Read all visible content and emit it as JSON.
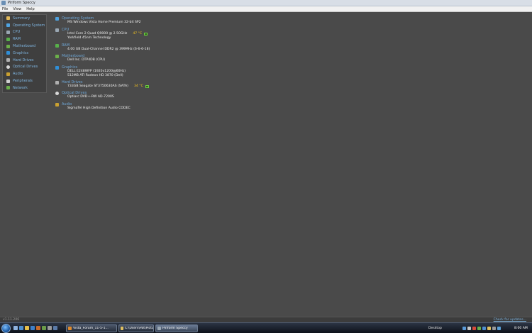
{
  "window": {
    "title": "Piriform Speccy"
  },
  "menu": [
    "File",
    "View",
    "Help"
  ],
  "sidebar": {
    "items": [
      {
        "label": "Summary",
        "icon": "summary-icon",
        "color": "#e0b85a"
      },
      {
        "label": "Operating System",
        "icon": "windows-icon",
        "color": "#4fa3e0"
      },
      {
        "label": "CPU",
        "icon": "cpu-icon",
        "color": "#9aa7b3"
      },
      {
        "label": "RAM",
        "icon": "ram-icon",
        "color": "#58b04a"
      },
      {
        "label": "Motherboard",
        "icon": "motherboard-icon",
        "color": "#6bb04a"
      },
      {
        "label": "Graphics",
        "icon": "graphics-icon",
        "color": "#2f8fd8"
      },
      {
        "label": "Hard Drives",
        "icon": "hard-drive-icon",
        "color": "#b0b0b0"
      },
      {
        "label": "Optical Drives",
        "icon": "optical-drive-icon",
        "color": "#d8d8d8"
      },
      {
        "label": "Audio",
        "icon": "audio-icon",
        "color": "#c9a030"
      },
      {
        "label": "Peripherals",
        "icon": "peripherals-icon",
        "color": "#d0d0d0"
      },
      {
        "label": "Network",
        "icon": "network-icon",
        "color": "#6ab04a"
      }
    ]
  },
  "summary": {
    "os": {
      "heading": "Operating System",
      "lines": [
        "MS Windows Vista Home Premium 32-bit SP2"
      ]
    },
    "cpu": {
      "heading": "CPU",
      "model": "Intel Core 2 Quad Q9000  @ 2.50GHz",
      "temp": "47 °C",
      "tech": "Yorkfield 45nm Technology"
    },
    "ram": {
      "heading": "RAM",
      "lines": [
        "4.00 GB Dual-Channel DDR2 @ 399MHz (6-6-6-18)"
      ]
    },
    "motherboard": {
      "heading": "Motherboard",
      "lines": [
        "Dell Inc. DTP4DB (CPU)"
      ]
    },
    "graphics": {
      "heading": "Graphics",
      "lines": [
        "DELL E248WFP (1920x1200@60Hz)",
        "512MB ATI Radeon HD 3870 (Dell)"
      ]
    },
    "hard_drives": {
      "heading": "Hard Drives",
      "model": "733GB Seagate ST3750630AS (SATA)",
      "temp": "34 °C"
    },
    "optical": {
      "heading": "Optical Drives",
      "lines": [
        "Optiarc DVD+-RW AD-7200S"
      ]
    },
    "audio": {
      "heading": "Audio",
      "lines": [
        "SigmaTel High Definition Audio CODEC"
      ]
    }
  },
  "status": {
    "version": "v1.11.206",
    "update_link": "Check for updates..."
  },
  "taskbar": {
    "tasks": [
      {
        "label": "Vista_Forum_11-5-1...",
        "color": "#e08a2a"
      },
      {
        "label": "C:\\Users\\Pat\\Pictures",
        "color": "#e0c060"
      },
      {
        "label": "Piriform Speccy",
        "color": "#9aa7b3"
      }
    ],
    "desktop_label": "Desktop",
    "clock": "8:00 AM"
  },
  "colors": {
    "accent_label": "#6fa8d8",
    "temperature": "#f0c020",
    "background": "#4a4a4a"
  }
}
